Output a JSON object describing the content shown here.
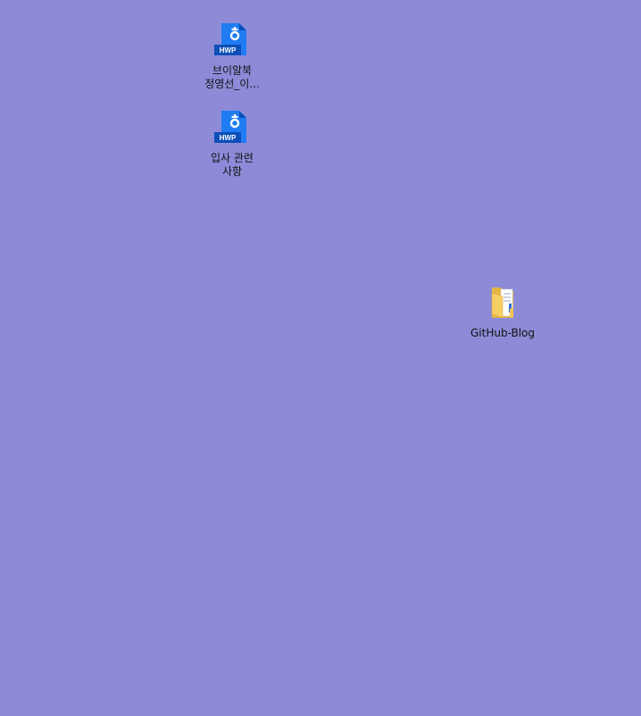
{
  "desktop": {
    "background_color": "#8d8bd8",
    "label_color": "#111111",
    "icons": [
      {
        "type": "hwp-file",
        "icon_name": "hwp-document-icon",
        "badge": "HWP",
        "label_line1": "브이알북",
        "label_line2": "정영선_이..."
      },
      {
        "type": "hwp-file",
        "icon_name": "hwp-document-icon",
        "badge": "HWP",
        "label_line1": "입사 관련",
        "label_line2": "사항"
      },
      {
        "type": "folder",
        "icon_name": "folder-icon",
        "label_line1": "GitHub-Blog"
      }
    ],
    "colors": {
      "hwp_blue": "#1f7cf3",
      "hwp_dark": "#0c4fb8",
      "folder_yellow": "#f7cf63"
    }
  }
}
